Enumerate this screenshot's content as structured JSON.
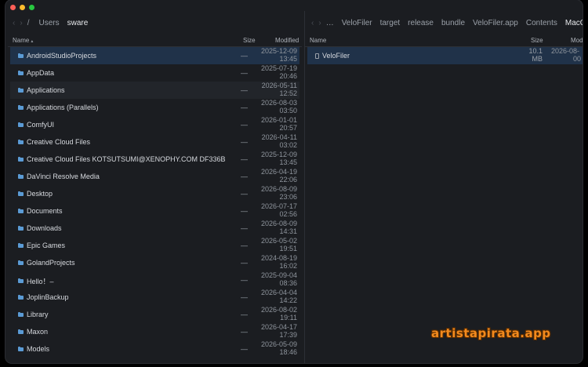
{
  "left_pane": {
    "breadcrumb": [
      "Users",
      "sware"
    ],
    "separator": "/",
    "columns": {
      "name": "Name",
      "size": "Size",
      "modified": "Modified"
    },
    "rows": [
      {
        "name": "AndroidStudioProjects",
        "size": "—",
        "date": "2025-12-09",
        "time": "13:45"
      },
      {
        "name": "AppData",
        "size": "—",
        "date": "2025-07-19",
        "time": "20:46"
      },
      {
        "name": "Applications",
        "size": "—",
        "date": "2026-05-11",
        "time": "12:52"
      },
      {
        "name": "Applications (Parallels)",
        "size": "—",
        "date": "2026-08-03",
        "time": "03:50"
      },
      {
        "name": "ComfyUI",
        "size": "—",
        "date": "2026-01-01",
        "time": "20:57"
      },
      {
        "name": "Creative Cloud Files",
        "size": "—",
        "date": "2026-04-11",
        "time": "03:02"
      },
      {
        "name": "Creative Cloud Files  KOTSUTSUMI@XENOPHY.COM DF336B",
        "size": "—",
        "date": "2025-12-09",
        "time": "13:45"
      },
      {
        "name": "DaVinci Resolve Media",
        "size": "—",
        "date": "2026-04-19",
        "time": "22:06"
      },
      {
        "name": "Desktop",
        "size": "—",
        "date": "2026-08-09",
        "time": "23:06"
      },
      {
        "name": "Documents",
        "size": "—",
        "date": "2026-07-17",
        "time": "02:56"
      },
      {
        "name": "Downloads",
        "size": "—",
        "date": "2026-08-09",
        "time": "14:31"
      },
      {
        "name": "Epic Games",
        "size": "—",
        "date": "2026-05-02",
        "time": "19:51"
      },
      {
        "name": "GolandProjects",
        "size": "—",
        "date": "2024-08-19",
        "time": "16:02"
      },
      {
        "name": "Hello！–",
        "size": "—",
        "date": "2025-09-04",
        "time": "08:36"
      },
      {
        "name": "JoplinBackup",
        "size": "—",
        "date": "2026-04-04",
        "time": "14:22"
      },
      {
        "name": "Library",
        "size": "—",
        "date": "2026-08-02",
        "time": "19:11"
      },
      {
        "name": "Maxon",
        "size": "—",
        "date": "2026-04-17",
        "time": "17:39"
      },
      {
        "name": "Models",
        "size": "—",
        "date": "2026-05-09",
        "time": "18:46"
      }
    ]
  },
  "right_pane": {
    "ellipsis": "…",
    "breadcrumb": [
      "VeloFiler",
      "target",
      "release",
      "bundle",
      "VeloFiler.app",
      "Contents"
    ],
    "active_crumb": "MacOS",
    "columns": {
      "name": "Name",
      "size": "Size",
      "modified": "Modif"
    },
    "rows": [
      {
        "name": "VeloFiler",
        "size": "10.1",
        "size_unit": "MB",
        "date": "2026-08-",
        "time": "00"
      }
    ]
  },
  "watermark": "artistapirata.app"
}
